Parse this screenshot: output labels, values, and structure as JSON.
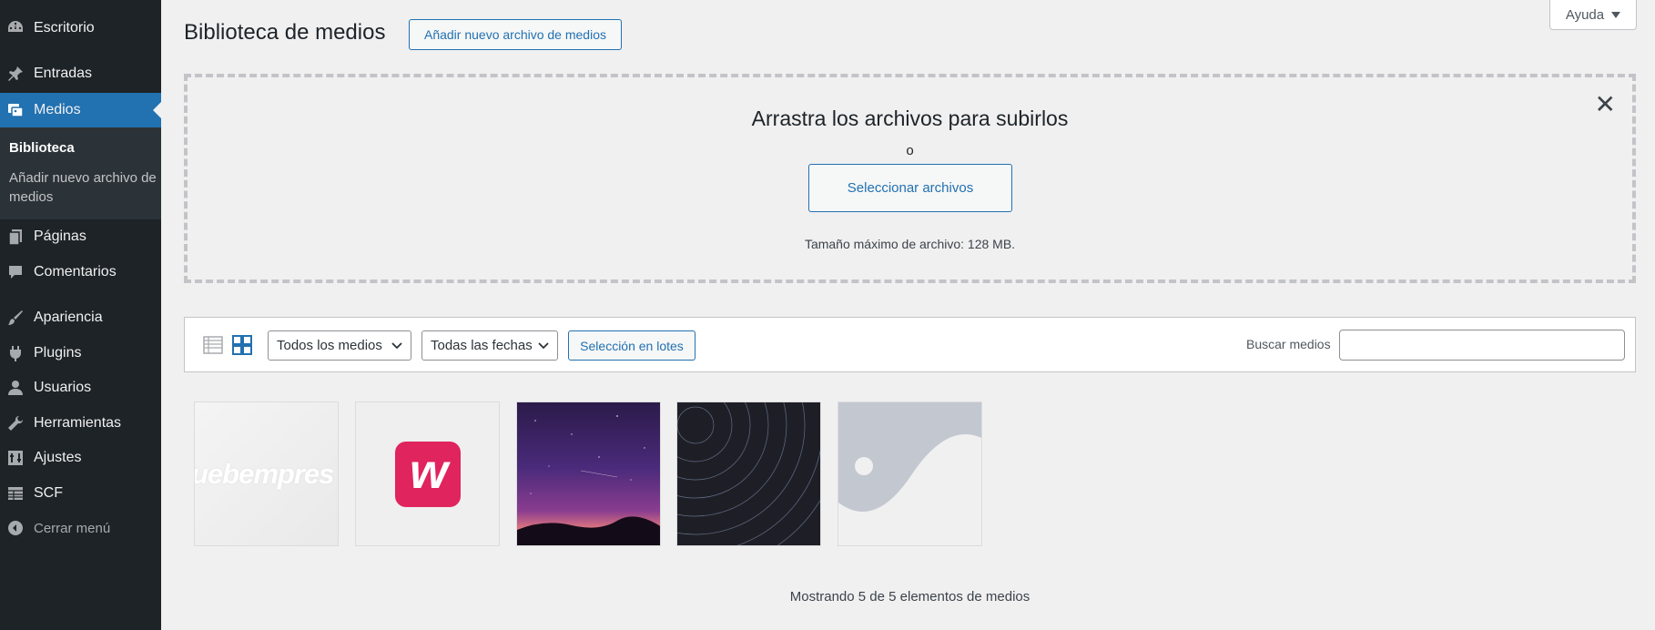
{
  "sidebar": {
    "items": [
      {
        "label": "Escritorio",
        "icon": "dashboard-icon"
      },
      {
        "label": "Entradas",
        "icon": "pin-icon"
      },
      {
        "label": "Medios",
        "icon": "media-icon"
      },
      {
        "label": "Páginas",
        "icon": "pages-icon"
      },
      {
        "label": "Comentarios",
        "icon": "comments-icon"
      },
      {
        "label": "Apariencia",
        "icon": "brush-icon"
      },
      {
        "label": "Plugins",
        "icon": "plugin-icon"
      },
      {
        "label": "Usuarios",
        "icon": "user-icon"
      },
      {
        "label": "Herramientas",
        "icon": "wrench-icon"
      },
      {
        "label": "Ajustes",
        "icon": "settings-icon"
      },
      {
        "label": "SCF",
        "icon": "table-icon"
      }
    ],
    "submenu": {
      "current": "Biblioteca",
      "add_new": "Añadir nuevo archivo de medios"
    },
    "collapse_label": "Cerrar menú"
  },
  "header": {
    "title": "Biblioteca de medios",
    "add_new_button": "Añadir nuevo archivo de medios",
    "help_label": "Ayuda"
  },
  "uploader": {
    "drop_text": "Arrastra los archivos para subirlos",
    "or_text": "o",
    "select_button": "Seleccionar archivos",
    "max_size": "Tamaño máximo de archivo: 128 MB."
  },
  "toolbar": {
    "media_filter": "Todos los medios",
    "date_filter": "Todas las fechas",
    "bulk_select": "Selección en lotes",
    "search_label": "Buscar medios",
    "search_value": ""
  },
  "media": [
    {
      "kind": "text-logo",
      "text": "uebempres"
    },
    {
      "kind": "brand-logo",
      "letter": "w"
    },
    {
      "kind": "photo-sunset"
    },
    {
      "kind": "photo-star-trails"
    },
    {
      "kind": "placeholder"
    }
  ],
  "footer": {
    "count_text": "Mostrando 5 de 5 elementos de medios"
  },
  "colors": {
    "sidebar_bg": "#1d2327",
    "active": "#2271b1",
    "brand_logo": "#e0245e"
  }
}
